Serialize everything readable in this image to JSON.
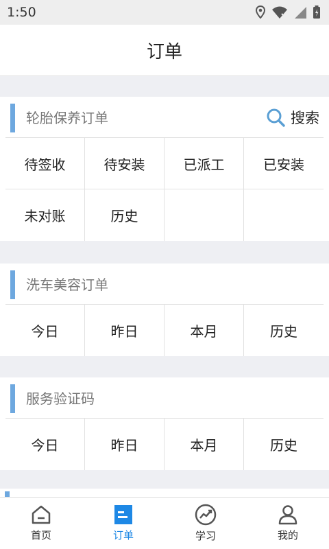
{
  "status_bar": {
    "time": "1:50"
  },
  "header": {
    "title": "订单"
  },
  "tire_orders": {
    "title": "轮胎保养订单",
    "search_label": "搜索",
    "cells": [
      "待签收",
      "待安装",
      "已派工",
      "已安装",
      "未对账",
      "历史",
      "",
      ""
    ]
  },
  "wash_orders": {
    "title": "洗车美容订单",
    "cells": [
      "今日",
      "昨日",
      "本月",
      "历史"
    ]
  },
  "verify_code": {
    "title": "服务验证码",
    "cells": [
      "今日",
      "昨日",
      "本月",
      "历史"
    ]
  },
  "tabbar": {
    "active_color": "#1e88e5",
    "items": [
      {
        "label": "首页",
        "icon": "home-icon"
      },
      {
        "label": "订单",
        "icon": "order-icon"
      },
      {
        "label": "学习",
        "icon": "chart-icon"
      },
      {
        "label": "我的",
        "icon": "user-icon"
      }
    ]
  }
}
